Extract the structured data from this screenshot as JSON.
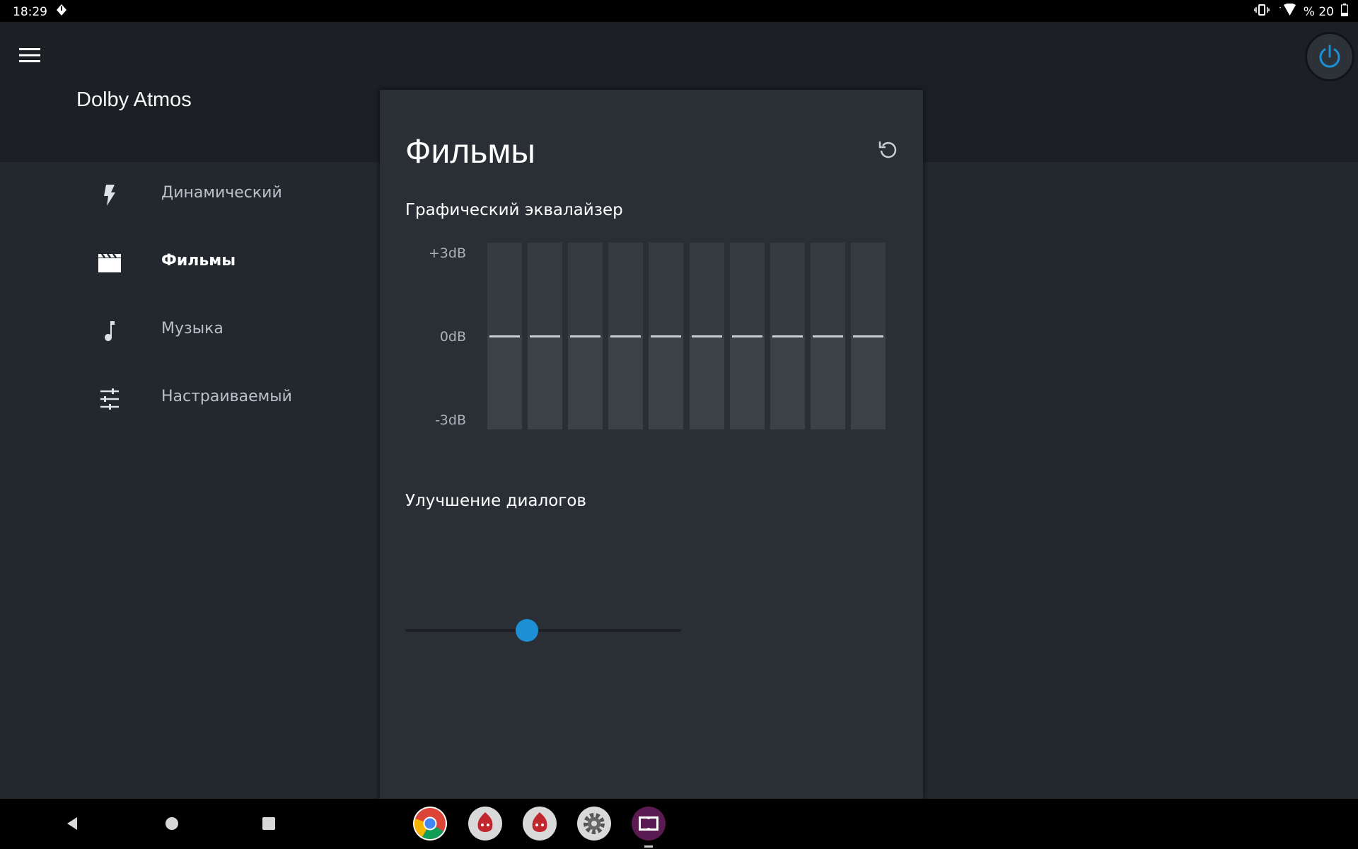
{
  "status_bar": {
    "time": "18:29",
    "battery_text": "% 20"
  },
  "app": {
    "title": "Dolby Atmos"
  },
  "sidebar": {
    "items": [
      {
        "label": "Динамический",
        "icon": "lightning-icon",
        "active": false
      },
      {
        "label": "Фильмы",
        "icon": "movie-clapper-icon",
        "active": true
      },
      {
        "label": "Музыка",
        "icon": "music-note-icon",
        "active": false
      },
      {
        "label": "Настраиваемый",
        "icon": "equalizer-sliders-icon",
        "active": false
      }
    ]
  },
  "panel": {
    "title": "Фильмы",
    "equalizer": {
      "title": "Графический эквалайзер",
      "labels": {
        "top": "+3dB",
        "mid": "0dB",
        "bottom": "-3dB"
      },
      "band_count": 10,
      "band_values_db": [
        0,
        0,
        0,
        0,
        0,
        0,
        0,
        0,
        0,
        0
      ]
    },
    "dialog": {
      "title": "Улучшение диалогов",
      "level": 0.44
    }
  },
  "colors": {
    "accent": "#1d8fd4",
    "background": "#23282e",
    "panel": "#2a2f35"
  },
  "dock": {
    "apps": [
      "chrome-app-icon",
      "antutu-3d-app-icon",
      "antutu-app-icon",
      "settings-app-icon",
      "dolby-app-icon"
    ]
  }
}
